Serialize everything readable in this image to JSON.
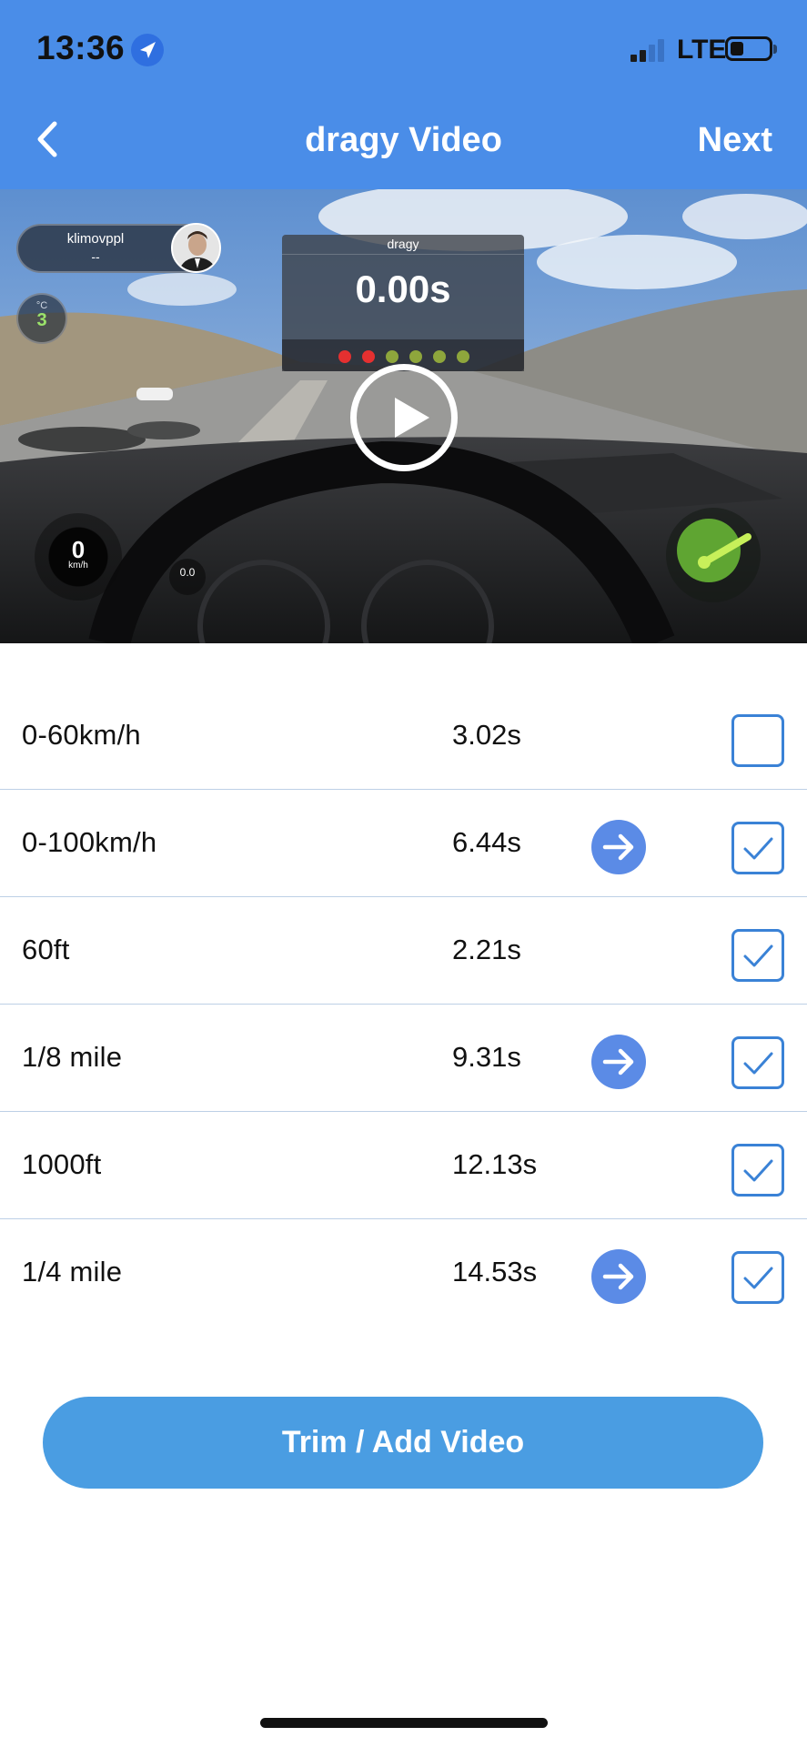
{
  "status_bar": {
    "time": "13:36",
    "network": "LTE"
  },
  "nav": {
    "title": "dragy Video",
    "next_label": "Next"
  },
  "video_overlay": {
    "username": "klimovppl",
    "user_subtext": "--",
    "temp_unit": "°C",
    "temp_value": "3",
    "brand": "dragy",
    "timer": "0.00s",
    "speed": "0",
    "speed_unit": "km/h",
    "g_value": "0.0",
    "lights": [
      "#e53030",
      "#e53030",
      "#8ea63c",
      "#8ea63c",
      "#8ea63c",
      "#8ea63c"
    ]
  },
  "results": [
    {
      "label": "0-60km/h",
      "time": "3.02s",
      "has_arrow": false,
      "checked": false
    },
    {
      "label": "0-100km/h",
      "time": "6.44s",
      "has_arrow": true,
      "checked": true
    },
    {
      "label": "60ft",
      "time": "2.21s",
      "has_arrow": false,
      "checked": true
    },
    {
      "label": "1/8 mile",
      "time": "9.31s",
      "has_arrow": true,
      "checked": true
    },
    {
      "label": "1000ft",
      "time": "12.13s",
      "has_arrow": false,
      "checked": true
    },
    {
      "label": "1/4 mile",
      "time": "14.53s",
      "has_arrow": true,
      "checked": true
    }
  ],
  "actions": {
    "trim_label": "Trim / Add Video"
  },
  "colors": {
    "header": "#4a8de8",
    "button": "#4a9de2",
    "checkbox": "#3a82d6",
    "arrow": "#5b8be6"
  }
}
